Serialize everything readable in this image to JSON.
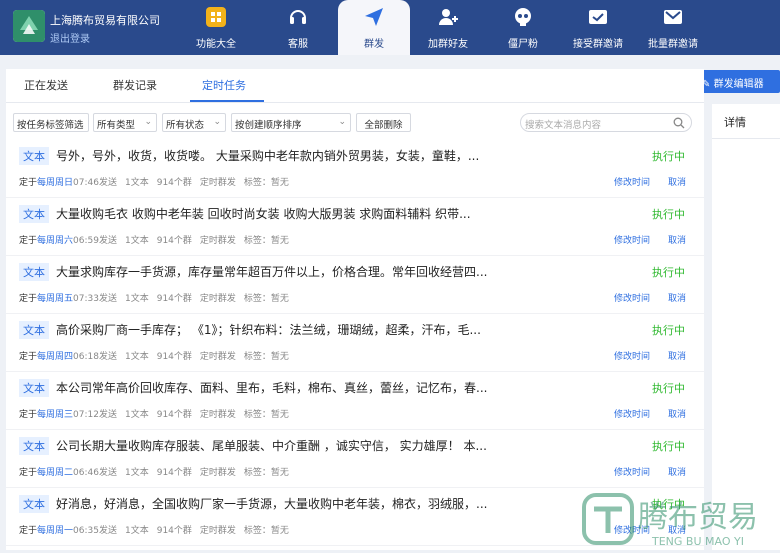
{
  "header": {
    "company": "上海腾布贸易有限公司",
    "logout": "退出登录",
    "nav": [
      {
        "label": "功能大全",
        "icon": "grid-icon"
      },
      {
        "label": "客服",
        "icon": "headset-icon"
      },
      {
        "label": "群发",
        "icon": "send-icon",
        "active": true
      },
      {
        "label": "加群好友",
        "icon": "add-user-icon"
      },
      {
        "label": "僵尸粉",
        "icon": "skull-icon"
      },
      {
        "label": "接受群邀请",
        "icon": "accept-invite-icon"
      },
      {
        "label": "批量群邀请",
        "icon": "batch-invite-icon"
      }
    ]
  },
  "tabs": [
    "正在发送",
    "群发记录",
    "定时任务"
  ],
  "active_tab": "定时任务",
  "filters": {
    "tag_filter": "按任务标签筛选",
    "type": "所有类型",
    "status": "所有状态",
    "sort": "按创建顺序排序",
    "delete_all": "全部删除",
    "search_placeholder": "搜索文本消息内容"
  },
  "editor_button": "群发编辑器",
  "detail_title": "详情",
  "labels": {
    "scheduled_prefix": "定于",
    "send_suffix": "发送",
    "modify": "修改时间",
    "cancel": "取消"
  },
  "tasks": [
    {
      "type": "文本",
      "text": "号外，号外，收货，收货喽。 大量采购中老年款内销外贸男装，女装，童鞋，...",
      "status": "执行中",
      "day": "每周周日",
      "time": "07:46",
      "count": "1文本",
      "groups": "914个群",
      "mode": "定时群发",
      "tag": "标签：暂无"
    },
    {
      "type": "文本",
      "text": "大量收购毛衣 收购中老年装 回收时尚女装 收购大版男装 求购面料辅料 织带...",
      "status": "执行中",
      "day": "每周周六",
      "time": "06:59",
      "count": "1文本",
      "groups": "914个群",
      "mode": "定时群发",
      "tag": "标签：暂无"
    },
    {
      "type": "文本",
      "text": "大量求购库存一手货源，库存量常年超百万件以上，价格合理。常年回收经营四...",
      "status": "执行中",
      "day": "每周周五",
      "time": "07:33",
      "count": "1文本",
      "groups": "914个群",
      "mode": "定时群发",
      "tag": "标签：暂无"
    },
    {
      "type": "文本",
      "text": "高价采购厂商一手库存； 《1》；针织布料：法兰绒，珊瑚绒，超柔，汗布，毛...",
      "status": "执行中",
      "day": "每周周四",
      "time": "06:18",
      "count": "1文本",
      "groups": "914个群",
      "mode": "定时群发",
      "tag": "标签：暂无"
    },
    {
      "type": "文本",
      "text": "本公司常年高价回收库存、面料、里布，毛料，棉布、真丝，蕾丝，记忆布，春...",
      "status": "执行中",
      "day": "每周周三",
      "time": "07:12",
      "count": "1文本",
      "groups": "914个群",
      "mode": "定时群发",
      "tag": "标签：暂无"
    },
    {
      "type": "文本",
      "text": "公司长期大量收购库存服装、尾单服装、中介重酬 ，诚实守信， 实力雄厚！ 本...",
      "status": "执行中",
      "day": "每周周二",
      "time": "06:46",
      "count": "1文本",
      "groups": "914个群",
      "mode": "定时群发",
      "tag": "标签：暂无"
    },
    {
      "type": "文本",
      "text": "好消息，好消息，全国收购厂家一手货源，大量收购中老年装，棉衣，羽绒服，...",
      "status": "执行中",
      "day": "每周周一",
      "time": "06:35",
      "count": "1文本",
      "groups": "914个群",
      "mode": "定时群发",
      "tag": "标签：暂无"
    }
  ],
  "watermark": {
    "cn": "腾布贸易",
    "en": "TENG BU MAO YI"
  }
}
